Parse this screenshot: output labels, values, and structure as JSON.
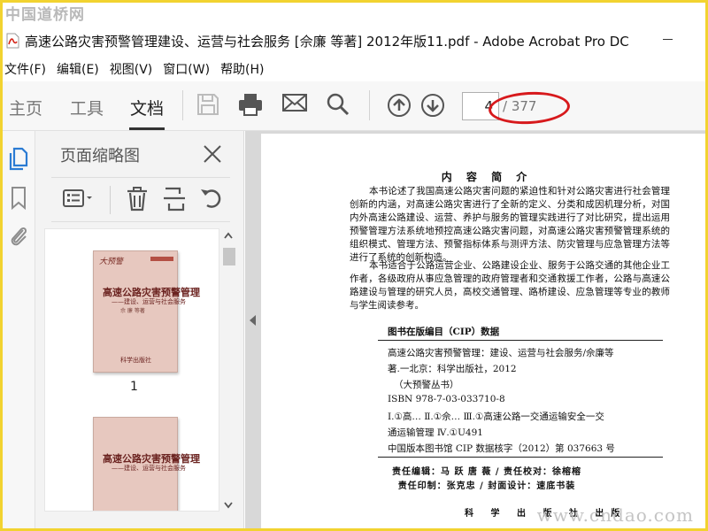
{
  "watermarks": {
    "top": "中国道桥网",
    "bottom": "www.cndao.com"
  },
  "window": {
    "title": "高速公路灾害预警管理建设、运营与社会服务 [佘廉 等著] 2012年版11.pdf - Adobe Acrobat Pro DC"
  },
  "menu": [
    "文件(F)",
    "编辑(E)",
    "视图(V)",
    "窗口(W)",
    "帮助(H)"
  ],
  "tabs": [
    "主页",
    "工具",
    "文档"
  ],
  "active_tab": "文档",
  "toolbar": {
    "page_current": "4",
    "page_total": "/ 377"
  },
  "panel": {
    "title": "页面缩略图"
  },
  "thumbnails": [
    {
      "page": "1",
      "top_mark": "大预警",
      "title": "高速公路灾害预警管理",
      "subtitle": "——建设、运营与社会服务",
      "authors": "佘 廉 等著",
      "publisher": "科学出版社"
    },
    {
      "title": "高速公路灾害预警管理",
      "subtitle": "——建设、运营与社会服务"
    }
  ],
  "document": {
    "heading": "内 容 简 介",
    "para1": "本书论述了我国高速公路灾害问题的紧迫性和针对公路灾害进行社会管理创新的内涵，对高速公路灾害进行了全新的定义、分类和成因机理分析，对国内外高速公路建设、运营、养护与服务的管理实践进行了对比研究，提出运用预警管理方法系统地预控高速公路灾害问题，对高速公路灾害预警管理系统的组织模式、管理方法、预警指标体系与测评方法、防灾管理与应急管理方法等进行了系统的创新构造。",
    "para2": "本书适合于公路运营企业、公路建设企业、服务于公路交通的其他企业工作者，各级政府从事应急管理的政府管理者和交通救援工作者，公路与高速公路建设与管理的研究人员，高校交通管理、路桥建设、应急管理等专业的教师与学生阅读参考。",
    "cip_title": "图书在版编目（CIP）数据",
    "cip_lines": [
      "高速公路灾害预警管理：建设、运营与社会服务/佘廉等",
      "著.一北京：科学出版社，2012",
      "（大预警丛书）",
      "ISBN 978-7-03-033710-8",
      "Ⅰ.①高…  Ⅱ.①佘…  Ⅲ.①高速公路一交通运输安全一交",
      "通运输管理  Ⅳ.①U491",
      "中国版本图书馆 CIP 数据核字（2012）第 037663 号"
    ],
    "credits": [
      "责任编辑：马 跃  唐 薇 / 责任校对：徐榕榕",
      "责任印制：张克忠 / 封面设计：速底书装"
    ],
    "cut_line": "科 学 出 版 社 出版"
  }
}
